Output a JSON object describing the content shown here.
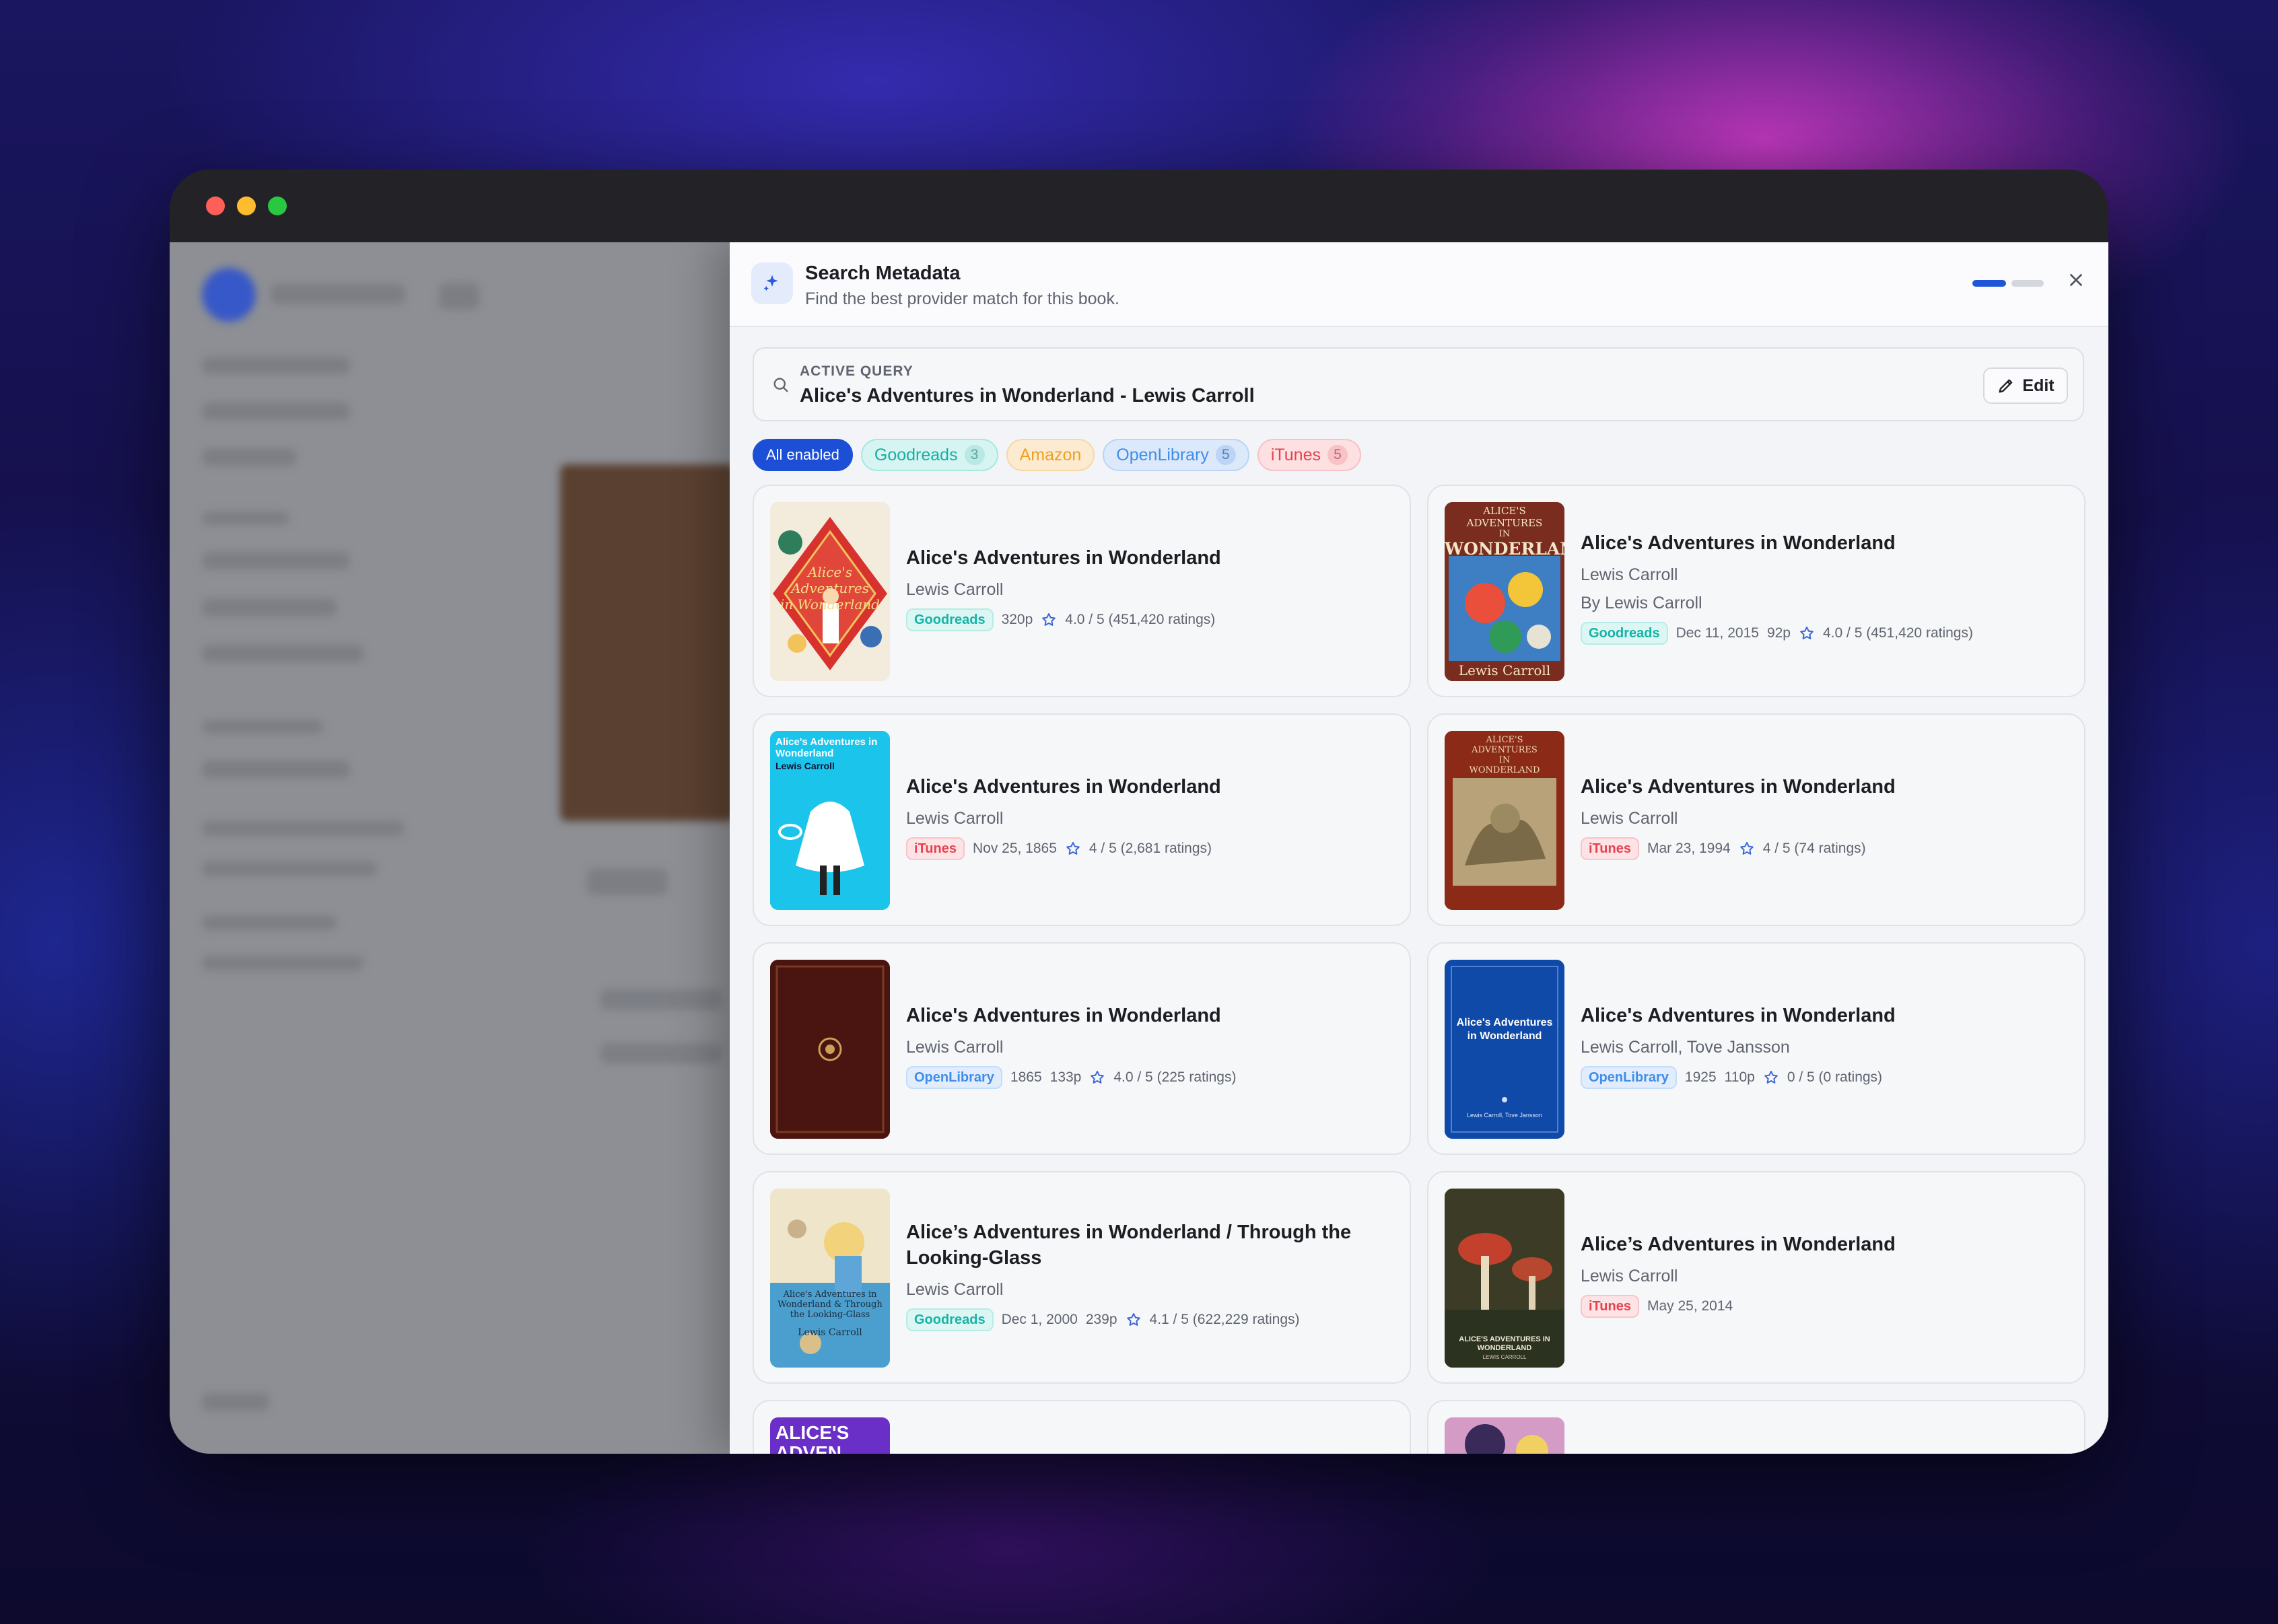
{
  "drawer": {
    "title": "Search Metadata",
    "subtitle": "Find the best provider match for this book."
  },
  "query": {
    "label": "ACTIVE QUERY",
    "value": "Alice's Adventures in Wonderland - Lewis Carroll",
    "edit_label": "Edit"
  },
  "filters": {
    "all": "All enabled",
    "goodreads": {
      "label": "Goodreads",
      "count": "3"
    },
    "amazon": {
      "label": "Amazon"
    },
    "openlibrary": {
      "label": "OpenLibrary",
      "count": "5"
    },
    "itunes": {
      "label": "iTunes",
      "count": "5"
    }
  },
  "results": [
    {
      "title": "Alice's Adventures in Wonderland",
      "author": "Lewis Carroll",
      "provider": "Goodreads",
      "pages": "320p",
      "rating": "4.0 / 5 (451,420 ratings)"
    },
    {
      "title": "Alice's Adventures in Wonderland",
      "author": "Lewis Carroll",
      "by": "By Lewis Carroll",
      "provider": "Goodreads",
      "date": "Dec 11, 2015",
      "pages": "92p",
      "rating": "4.0 / 5 (451,420 ratings)"
    },
    {
      "title": "Alice's Adventures in Wonderland",
      "author": "Lewis Carroll",
      "provider": "iTunes",
      "date": "Nov 25, 1865",
      "rating": "4 / 5 (2,681 ratings)"
    },
    {
      "title": "Alice's Adventures in Wonderland",
      "author": "Lewis Carroll",
      "provider": "iTunes",
      "date": "Mar 23, 1994",
      "rating": "4 / 5 (74 ratings)"
    },
    {
      "title": "Alice's Adventures in Wonderland",
      "author": "Lewis Carroll",
      "provider": "OpenLibrary",
      "date": "1865",
      "pages": "133p",
      "rating": "4.0 / 5 (225 ratings)"
    },
    {
      "title": "Alice's Adventures in Wonderland",
      "author": "Lewis Carroll, Tove Jansson",
      "provider": "OpenLibrary",
      "date": "1925",
      "pages": "110p",
      "rating": "0 / 5 (0 ratings)"
    },
    {
      "title": "Alice’s Adventures in Wonderland / Through the Looking-Glass",
      "author": "Lewis Carroll",
      "provider": "Goodreads",
      "date": "Dec 1, 2000",
      "pages": "239p",
      "rating": "4.1 / 5 (622,229 ratings)"
    },
    {
      "title": "Alice’s Adventures in Wonderland",
      "author": "Lewis Carroll",
      "provider": "iTunes",
      "date": "May 25, 2014"
    }
  ],
  "covers": {
    "c1": {
      "line1": "Alice's Adventures",
      "line2": "in Wonderland"
    },
    "c2": {
      "top": "ALICE'S ADVENTURES",
      "mid": "IN",
      "big": "WONDERLAND",
      "foot": "Lewis Carroll"
    },
    "c3": {
      "title": "Alice's Adventures in Wonderland",
      "author": "Lewis Carroll"
    },
    "c4": {
      "top": "ALICE'S",
      "mid": "ADVENTURES",
      "mid2": "IN",
      "bot": "WONDERLAND"
    },
    "c6": {
      "title": "Alice's Adventures in Wonderland",
      "author": "Lewis Carroll, Tove Jansson"
    },
    "c7": {
      "title": "Alice's Adventures in Wonderland & Through the Looking-Glass",
      "author": "Lewis Carroll"
    },
    "c8": {
      "title": "ALICE'S ADVENTURES IN WONDERLAND",
      "author": "LEWIS CARROLL"
    },
    "c9": {
      "title": "ALICE'S ADVEN"
    }
  },
  "colors": {
    "accent": "#1f55d8",
    "goodreads": "#14b4a6",
    "amazon": "#f2a01a",
    "openlibrary": "#3f8de8",
    "itunes": "#e5424d"
  }
}
